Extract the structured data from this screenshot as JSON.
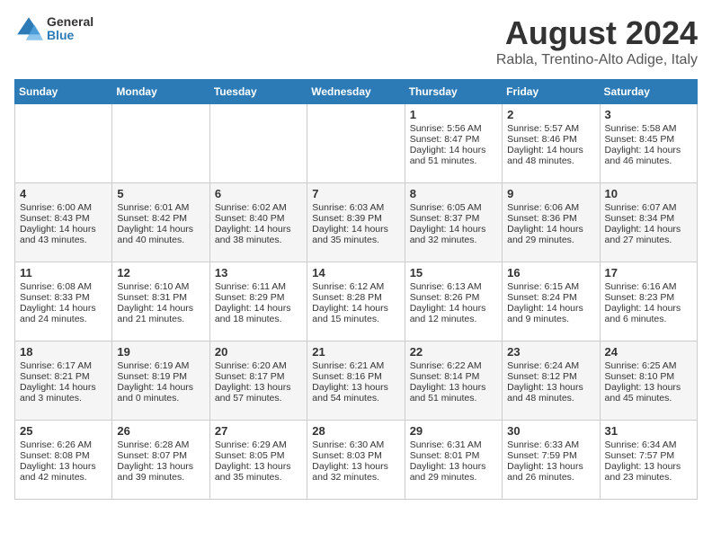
{
  "header": {
    "logo_general": "General",
    "logo_blue": "Blue",
    "main_title": "August 2024",
    "subtitle": "Rabla, Trentino-Alto Adige, Italy"
  },
  "days_of_week": [
    "Sunday",
    "Monday",
    "Tuesday",
    "Wednesday",
    "Thursday",
    "Friday",
    "Saturday"
  ],
  "weeks": [
    [
      {
        "day": "",
        "info": ""
      },
      {
        "day": "",
        "info": ""
      },
      {
        "day": "",
        "info": ""
      },
      {
        "day": "",
        "info": ""
      },
      {
        "day": "1",
        "info": "Sunrise: 5:56 AM\nSunset: 8:47 PM\nDaylight: 14 hours\nand 51 minutes."
      },
      {
        "day": "2",
        "info": "Sunrise: 5:57 AM\nSunset: 8:46 PM\nDaylight: 14 hours\nand 48 minutes."
      },
      {
        "day": "3",
        "info": "Sunrise: 5:58 AM\nSunset: 8:45 PM\nDaylight: 14 hours\nand 46 minutes."
      }
    ],
    [
      {
        "day": "4",
        "info": "Sunrise: 6:00 AM\nSunset: 8:43 PM\nDaylight: 14 hours\nand 43 minutes."
      },
      {
        "day": "5",
        "info": "Sunrise: 6:01 AM\nSunset: 8:42 PM\nDaylight: 14 hours\nand 40 minutes."
      },
      {
        "day": "6",
        "info": "Sunrise: 6:02 AM\nSunset: 8:40 PM\nDaylight: 14 hours\nand 38 minutes."
      },
      {
        "day": "7",
        "info": "Sunrise: 6:03 AM\nSunset: 8:39 PM\nDaylight: 14 hours\nand 35 minutes."
      },
      {
        "day": "8",
        "info": "Sunrise: 6:05 AM\nSunset: 8:37 PM\nDaylight: 14 hours\nand 32 minutes."
      },
      {
        "day": "9",
        "info": "Sunrise: 6:06 AM\nSunset: 8:36 PM\nDaylight: 14 hours\nand 29 minutes."
      },
      {
        "day": "10",
        "info": "Sunrise: 6:07 AM\nSunset: 8:34 PM\nDaylight: 14 hours\nand 27 minutes."
      }
    ],
    [
      {
        "day": "11",
        "info": "Sunrise: 6:08 AM\nSunset: 8:33 PM\nDaylight: 14 hours\nand 24 minutes."
      },
      {
        "day": "12",
        "info": "Sunrise: 6:10 AM\nSunset: 8:31 PM\nDaylight: 14 hours\nand 21 minutes."
      },
      {
        "day": "13",
        "info": "Sunrise: 6:11 AM\nSunset: 8:29 PM\nDaylight: 14 hours\nand 18 minutes."
      },
      {
        "day": "14",
        "info": "Sunrise: 6:12 AM\nSunset: 8:28 PM\nDaylight: 14 hours\nand 15 minutes."
      },
      {
        "day": "15",
        "info": "Sunrise: 6:13 AM\nSunset: 8:26 PM\nDaylight: 14 hours\nand 12 minutes."
      },
      {
        "day": "16",
        "info": "Sunrise: 6:15 AM\nSunset: 8:24 PM\nDaylight: 14 hours\nand 9 minutes."
      },
      {
        "day": "17",
        "info": "Sunrise: 6:16 AM\nSunset: 8:23 PM\nDaylight: 14 hours\nand 6 minutes."
      }
    ],
    [
      {
        "day": "18",
        "info": "Sunrise: 6:17 AM\nSunset: 8:21 PM\nDaylight: 14 hours\nand 3 minutes."
      },
      {
        "day": "19",
        "info": "Sunrise: 6:19 AM\nSunset: 8:19 PM\nDaylight: 14 hours\nand 0 minutes."
      },
      {
        "day": "20",
        "info": "Sunrise: 6:20 AM\nSunset: 8:17 PM\nDaylight: 13 hours\nand 57 minutes."
      },
      {
        "day": "21",
        "info": "Sunrise: 6:21 AM\nSunset: 8:16 PM\nDaylight: 13 hours\nand 54 minutes."
      },
      {
        "day": "22",
        "info": "Sunrise: 6:22 AM\nSunset: 8:14 PM\nDaylight: 13 hours\nand 51 minutes."
      },
      {
        "day": "23",
        "info": "Sunrise: 6:24 AM\nSunset: 8:12 PM\nDaylight: 13 hours\nand 48 minutes."
      },
      {
        "day": "24",
        "info": "Sunrise: 6:25 AM\nSunset: 8:10 PM\nDaylight: 13 hours\nand 45 minutes."
      }
    ],
    [
      {
        "day": "25",
        "info": "Sunrise: 6:26 AM\nSunset: 8:08 PM\nDaylight: 13 hours\nand 42 minutes."
      },
      {
        "day": "26",
        "info": "Sunrise: 6:28 AM\nSunset: 8:07 PM\nDaylight: 13 hours\nand 39 minutes."
      },
      {
        "day": "27",
        "info": "Sunrise: 6:29 AM\nSunset: 8:05 PM\nDaylight: 13 hours\nand 35 minutes."
      },
      {
        "day": "28",
        "info": "Sunrise: 6:30 AM\nSunset: 8:03 PM\nDaylight: 13 hours\nand 32 minutes."
      },
      {
        "day": "29",
        "info": "Sunrise: 6:31 AM\nSunset: 8:01 PM\nDaylight: 13 hours\nand 29 minutes."
      },
      {
        "day": "30",
        "info": "Sunrise: 6:33 AM\nSunset: 7:59 PM\nDaylight: 13 hours\nand 26 minutes."
      },
      {
        "day": "31",
        "info": "Sunrise: 6:34 AM\nSunset: 7:57 PM\nDaylight: 13 hours\nand 23 minutes."
      }
    ]
  ]
}
